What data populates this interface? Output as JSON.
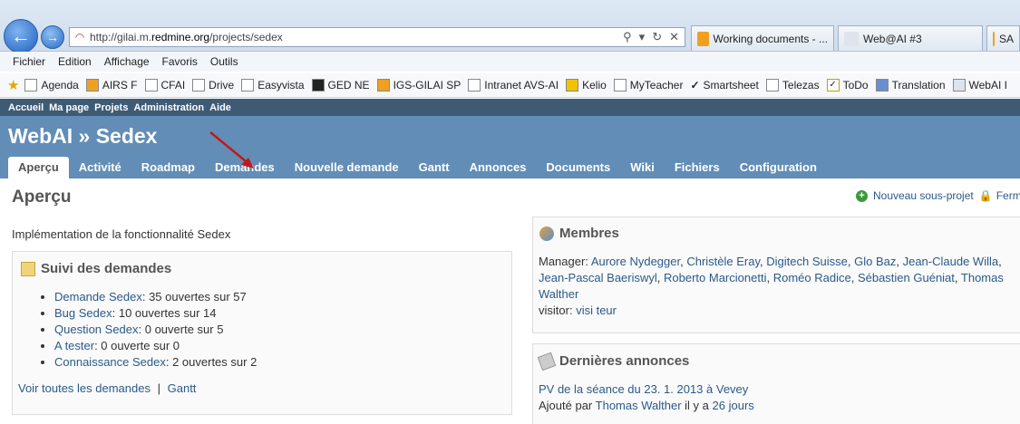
{
  "browser": {
    "url_prefix": "http://gilai.m.",
    "url_domain": "redmine.org",
    "url_path": "/projects/sedex",
    "tabs": [
      {
        "label": "Working documents - ..."
      },
      {
        "label": "Web@AI #3"
      },
      {
        "label": "SA"
      }
    ],
    "menu": [
      "Fichier",
      "Edition",
      "Affichage",
      "Favoris",
      "Outils"
    ],
    "favorites": [
      "Agenda",
      "AIRS F",
      "CFAI",
      "Drive",
      "Easyvista",
      "GED NE",
      "IGS-GILAI SP",
      "Intranet AVS-AI",
      "Kelio",
      "MyTeacher",
      "Smartsheet",
      "Telezas",
      "ToDo",
      "Translation",
      "WebAI I"
    ]
  },
  "top_menu": [
    "Accueil",
    "Ma page",
    "Projets",
    "Administration",
    "Aide"
  ],
  "project_title": "WebAI » Sedex",
  "main_menu": [
    "Aperçu",
    "Activité",
    "Roadmap",
    "Demandes",
    "Nouvelle demande",
    "Gantt",
    "Annonces",
    "Documents",
    "Wiki",
    "Fichiers",
    "Configuration"
  ],
  "page": {
    "title": "Aperçu",
    "new_subproject": "Nouveau sous-projet",
    "close": "Ferm",
    "description": "Implémentation de la fonctionnalité Sedex"
  },
  "issues": {
    "heading": "Suivi des demandes",
    "trackers": [
      {
        "name": "Demande Sedex",
        "text": ": 35 ouvertes sur 57"
      },
      {
        "name": "Bug Sedex",
        "text": ": 10 ouvertes sur 14"
      },
      {
        "name": "Question Sedex",
        "text": ": 0 ouverte sur 5"
      },
      {
        "name": "A tester",
        "text": ": 0 ouverte sur 0"
      },
      {
        "name": "Connaissance Sedex",
        "text": ": 2 ouvertes sur 2"
      }
    ],
    "view_all": "Voir toutes les demandes",
    "separator": "|",
    "gantt": "Gantt"
  },
  "members": {
    "heading": "Membres",
    "manager_label": "Manager:",
    "managers": [
      "Aurore Nydegger",
      "Christèle Eray",
      "Digitech Suisse",
      "Glo Baz",
      "Jean-Claude Willa",
      "Jean-Pascal Baeriswyl",
      "Roberto Marcionetti",
      "Roméo Radice",
      "Sébastien Guéniat",
      "Thomas Walther"
    ],
    "visitor_label": "visitor:",
    "visitor": "visi teur"
  },
  "news": {
    "heading": "Dernières annonces",
    "title": "PV de la séance du 23. 1. 2013 à Vevey",
    "added_by": "Ajouté par",
    "author": "Thomas Walther",
    "ago_prefix": "il y a",
    "ago": "26 jours"
  }
}
